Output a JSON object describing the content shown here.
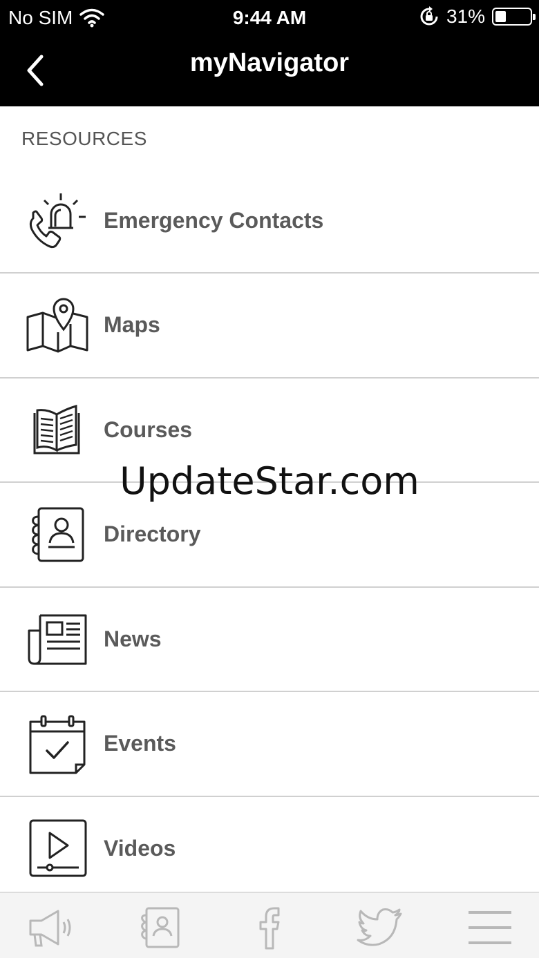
{
  "status_bar": {
    "carrier": "No SIM",
    "time": "9:44 AM",
    "battery": "31%",
    "battery_level": 0.31
  },
  "nav": {
    "title": "myNavigator",
    "back_icon": "chevron-left-icon"
  },
  "section": {
    "title": "RESOURCES"
  },
  "items": [
    {
      "label": "Emergency Contacts",
      "icon": "emergency-phone-icon"
    },
    {
      "label": "Maps",
      "icon": "map-icon"
    },
    {
      "label": "Courses",
      "icon": "book-icon"
    },
    {
      "label": "Directory",
      "icon": "contact-book-icon"
    },
    {
      "label": "News",
      "icon": "newspaper-icon"
    },
    {
      "label": "Events",
      "icon": "calendar-check-icon"
    },
    {
      "label": "Videos",
      "icon": "video-play-icon"
    }
  ],
  "watermark": "UpdateStar.com",
  "tab_bar": {
    "tabs": [
      {
        "icon": "megaphone-icon"
      },
      {
        "icon": "contact-book-icon"
      },
      {
        "icon": "facebook-icon"
      },
      {
        "icon": "twitter-icon"
      },
      {
        "icon": "menu-icon"
      }
    ]
  },
  "colors": {
    "header_bg": "#000000",
    "text": "#5a5a5a",
    "divider": "#d0d0d0",
    "tab_icon": "#b8b8b8"
  }
}
